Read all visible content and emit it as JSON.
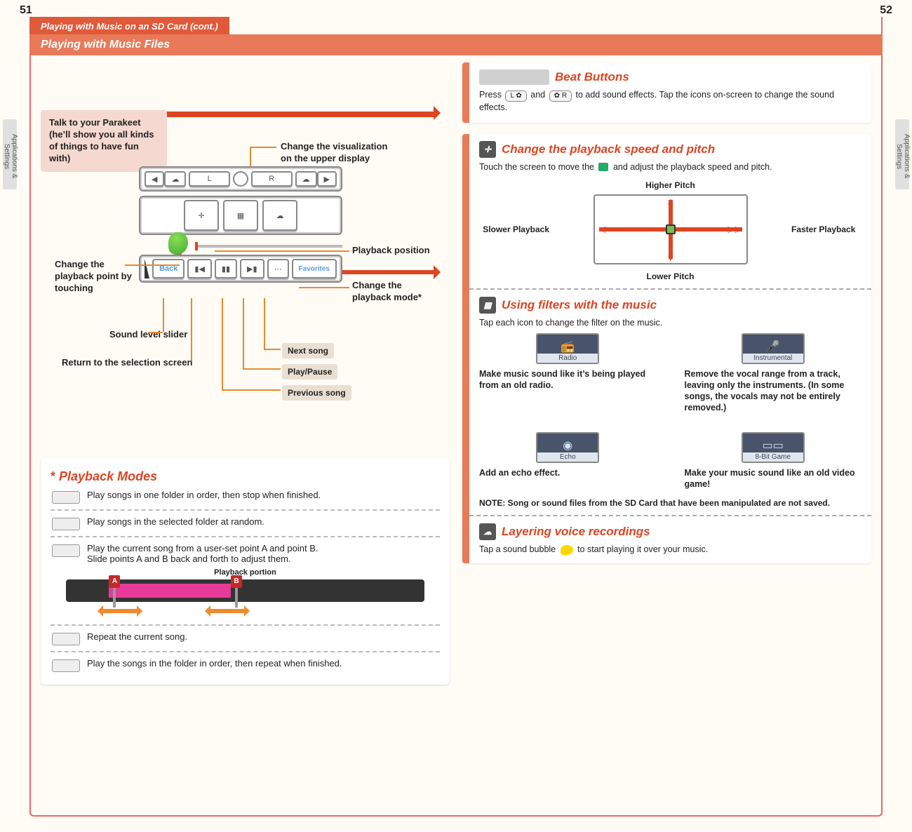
{
  "page_left": "51",
  "page_right": "52",
  "side_tab": "Applications & Settings",
  "h1": "Playing with Music on an SD Card (cont.)",
  "h2": "Playing with Music Files",
  "diagram": {
    "parakeet": "Talk to your Parakeet (he’ll show you all kinds of things to have fun with)",
    "visualization": "Change the visualization on the upper display",
    "playback_position": "Playback position",
    "playback_point": "Change the playback point by touching",
    "playback_mode": "Change the playback mode*",
    "sound_level": "Sound level slider",
    "return": "Return to the selection screen",
    "next": "Next song",
    "playpause": "Play/Pause",
    "prev": "Previous song",
    "back_btn": "Back",
    "fav_btn": "Favorites",
    "l_btn": "L",
    "r_btn": "R"
  },
  "playback": {
    "title_star": "*",
    "title": "Playback Modes",
    "m1": "Play songs in one folder in order, then stop when finished.",
    "m2": "Play songs in the selected folder at random.",
    "m3a": "Play the current song from a user-set point A and point B.",
    "m3b": "Slide points A and B back and forth to adjust them.",
    "portion": "Playback portion",
    "a": "A",
    "b": "B",
    "m4": "Repeat the current song.",
    "m5": "Play the songs in the folder in order, then repeat when finished."
  },
  "beat": {
    "title": "Beat Buttons",
    "text_pre": "Press ",
    "btn_l": "L ✿",
    "btn_r": "✿ R",
    "text_mid": " and ",
    "text_post": " to add sound effects. Tap the icons on-screen to change the sound effects."
  },
  "speed": {
    "title": "Change the playback speed and pitch",
    "touch": "Touch the screen to move the ",
    "touch2": " and adjust the playback speed and pitch.",
    "higher": "Higher Pitch",
    "lower": "Lower Pitch",
    "slower": "Slower Playback",
    "faster": "Faster Playback"
  },
  "filters": {
    "title": "Using filters with the music",
    "tap": "Tap each icon to change the filter on the music.",
    "radio_label": "Radio",
    "radio_desc": "Make music sound like it’s being played from an old radio.",
    "inst_label": "Instrumental",
    "inst_desc": "Remove the vocal range from a track, leaving only the instruments. (In some songs, the vocals may not be entirely removed.)",
    "echo_label": "Echo",
    "echo_desc": "Add an echo effect.",
    "game_label": "8-Bit Game",
    "game_desc": "Make your music sound like an old video game!",
    "note": "NOTE: Song or sound files from the SD Card that have been manipulated are not saved."
  },
  "layer": {
    "title": "Layering voice recordings",
    "text_pre": "Tap a sound bubble ",
    "text_post": " to start playing it over your music."
  }
}
